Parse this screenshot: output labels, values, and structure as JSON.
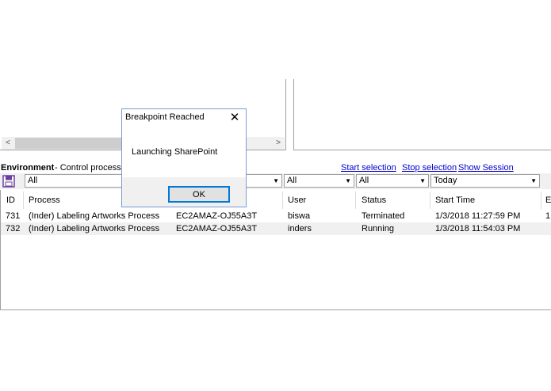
{
  "top_panes": {
    "scroll_left": "<",
    "scroll_right": ">"
  },
  "environment": {
    "title": "Environment",
    "subtitle": " - Control processe",
    "links": {
      "start_selection": "Start selection",
      "stop_selection": "Stop selection",
      "show_session_variables": "Show Session Variables"
    }
  },
  "filters": {
    "process": "All",
    "user": "All",
    "status": "All",
    "start_time": "Today",
    "dropdown_glyph": "▼"
  },
  "grid": {
    "headers": {
      "id": "ID",
      "process": "Process",
      "user": "User",
      "status": "Status",
      "start_time": "Start Time",
      "end": "E"
    },
    "rows": [
      {
        "id": "731",
        "process": "(Inder) Labeling Artworks Process",
        "resource": "EC2AMAZ-OJ55A3T",
        "user": "biswa",
        "status": "Terminated",
        "start_time": "1/3/2018 11:27:59 PM",
        "extra": "1"
      },
      {
        "id": "732",
        "process": "(Inder) Labeling Artworks Process",
        "resource": "EC2AMAZ-OJ55A3T",
        "user": "inders",
        "status": "Running",
        "start_time": "1/3/2018 11:54:03 PM",
        "extra": ""
      }
    ]
  },
  "dialog": {
    "title": "Breakpoint Reached",
    "close": "✕",
    "message": "Launching SharePoint",
    "ok_label": "OK"
  },
  "colors": {
    "link": "#0000cc",
    "dialog_border": "#7a9cd3",
    "ok_focus": "#0078d7"
  }
}
